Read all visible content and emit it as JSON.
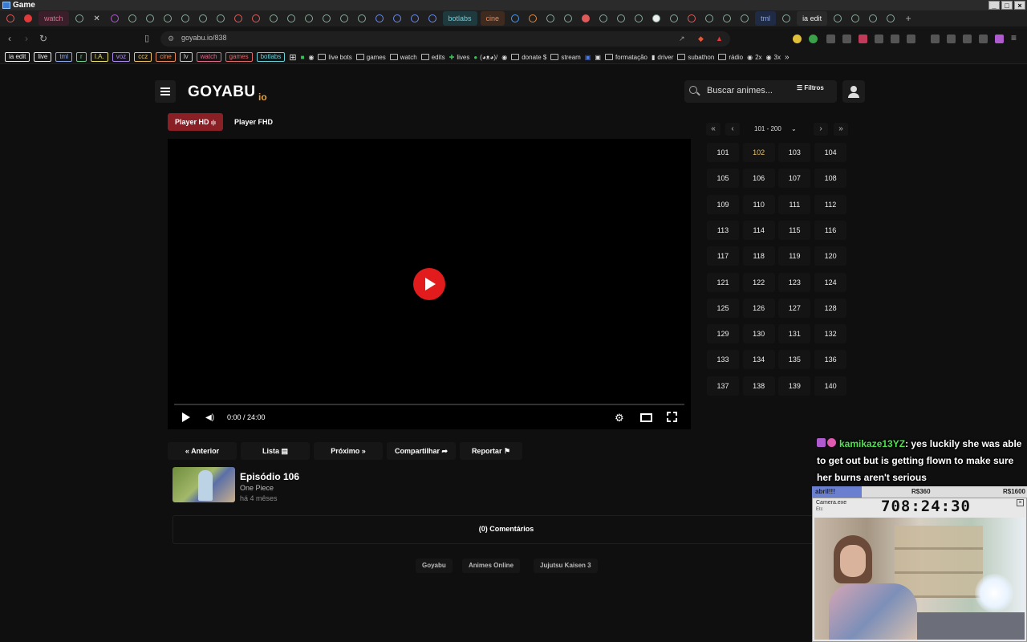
{
  "window": {
    "title": "Game"
  },
  "tabs": {
    "labels": [
      {
        "text": "watch",
        "bg": "#3a1f2a",
        "color": "#e06a8a"
      },
      {
        "text": "botlabs",
        "bg": "#1f3a3f",
        "color": "#6ad0d8"
      },
      {
        "text": "cine",
        "bg": "#3f2a1f",
        "color": "#e88a5a"
      },
      {
        "text": "tml",
        "bg": "#1f2a45",
        "color": "#8aa8f0"
      },
      {
        "text": "ia edit",
        "bg": "#2a2a2a",
        "color": "#eeeeee"
      }
    ]
  },
  "address": {
    "url": "goyabu.io/838"
  },
  "bookmarks": {
    "chips": [
      {
        "text": "ia edit",
        "color": "#eeeeee"
      },
      {
        "text": "live",
        "color": "#eeeeee"
      },
      {
        "text": "tml",
        "color": "#8aa8f0"
      },
      {
        "text": "r",
        "color": "#6ad08a"
      },
      {
        "text": "I.A.",
        "color": "#e8e06a"
      },
      {
        "text": "voz",
        "color": "#aa8af0"
      },
      {
        "text": "ccz",
        "color": "#e8c060"
      },
      {
        "text": "cine",
        "color": "#e88a5a"
      },
      {
        "text": "lv",
        "color": "#cccccc"
      },
      {
        "text": "watch",
        "color": "#e06a8a"
      },
      {
        "text": "games",
        "color": "#e06a6a"
      },
      {
        "text": "botlabs",
        "color": "#6ad0d8"
      }
    ],
    "items": [
      "live bots",
      "games",
      "watch",
      "edits",
      "lives",
      "(◕ᴥ◕)/",
      "donate $",
      "stream",
      "formatação",
      "driver",
      "subathon",
      "rádio",
      "2x",
      "3x"
    ]
  },
  "site": {
    "logo": "GOYABU",
    "logo_suffix": "io",
    "search_placeholder": "Buscar animes...",
    "filters_label": "Filtros"
  },
  "player": {
    "tabs": [
      {
        "label": "Player HD",
        "active": true
      },
      {
        "label": "Player FHD",
        "active": false
      }
    ],
    "time": "0:00 / 24:00",
    "progress": 0
  },
  "episode_nav": {
    "prev": "Anterior",
    "list": "Lista",
    "next": "Próximo",
    "share": "Compartilhar",
    "report": "Reportar"
  },
  "episode": {
    "title": "Episódio 106",
    "anime": "One Piece",
    "date": "há 4 mêses"
  },
  "comments": {
    "label": "(0) Comentários"
  },
  "footer": {
    "links": [
      "Goyabu",
      "Animes Online",
      "Jujutsu Kaisen 3"
    ]
  },
  "episode_panel": {
    "range": "101 - 200",
    "episodes": [
      "101",
      "102",
      "103",
      "104",
      "105",
      "106",
      "107",
      "108",
      "109",
      "110",
      "111",
      "112",
      "113",
      "114",
      "115",
      "116",
      "117",
      "118",
      "119",
      "120",
      "121",
      "122",
      "123",
      "124",
      "125",
      "126",
      "127",
      "128",
      "129",
      "130",
      "131",
      "132",
      "133",
      "134",
      "135",
      "136",
      "137",
      "138",
      "139",
      "140"
    ],
    "watched": [
      "102"
    ]
  },
  "overlay": {
    "chat_user": "kamikaze13YZ",
    "chat_text": ": yes luckily she was able to get out but is getting flown to make sure her burns aren't serious",
    "goal_left": "abril!!!",
    "goal_mid": "R$360",
    "goal_right": "R$1600",
    "goal_progress": 0.23,
    "cam_title": "Camera.exe",
    "cam_sub": "Etc",
    "timer": "708:24:30"
  }
}
